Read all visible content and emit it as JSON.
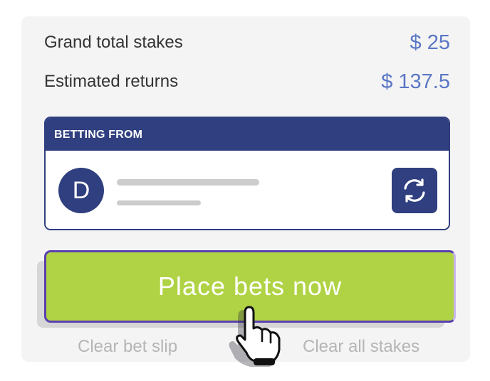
{
  "summary": {
    "stakes_label": "Grand total stakes",
    "stakes_value": "$ 25",
    "returns_label": "Estimated returns",
    "returns_value": "$ 137.5"
  },
  "account": {
    "header": "BETTING FROM",
    "avatar_letter": "D",
    "refresh_icon": "refresh-icon"
  },
  "actions": {
    "place_bets_label": "Place bets now",
    "clear_slip_label": "Clear bet slip",
    "clear_stakes_label": "Clear all stakes"
  },
  "colors": {
    "accent_blue": "#2f3f7f",
    "value_blue": "#5a76c5",
    "place_green": "#b0d345",
    "place_border": "#5b3fb0",
    "panel_bg": "#f4f4f4",
    "link_grey": "#b5b5b5"
  },
  "cursor_icon": "hand-pointer-icon"
}
